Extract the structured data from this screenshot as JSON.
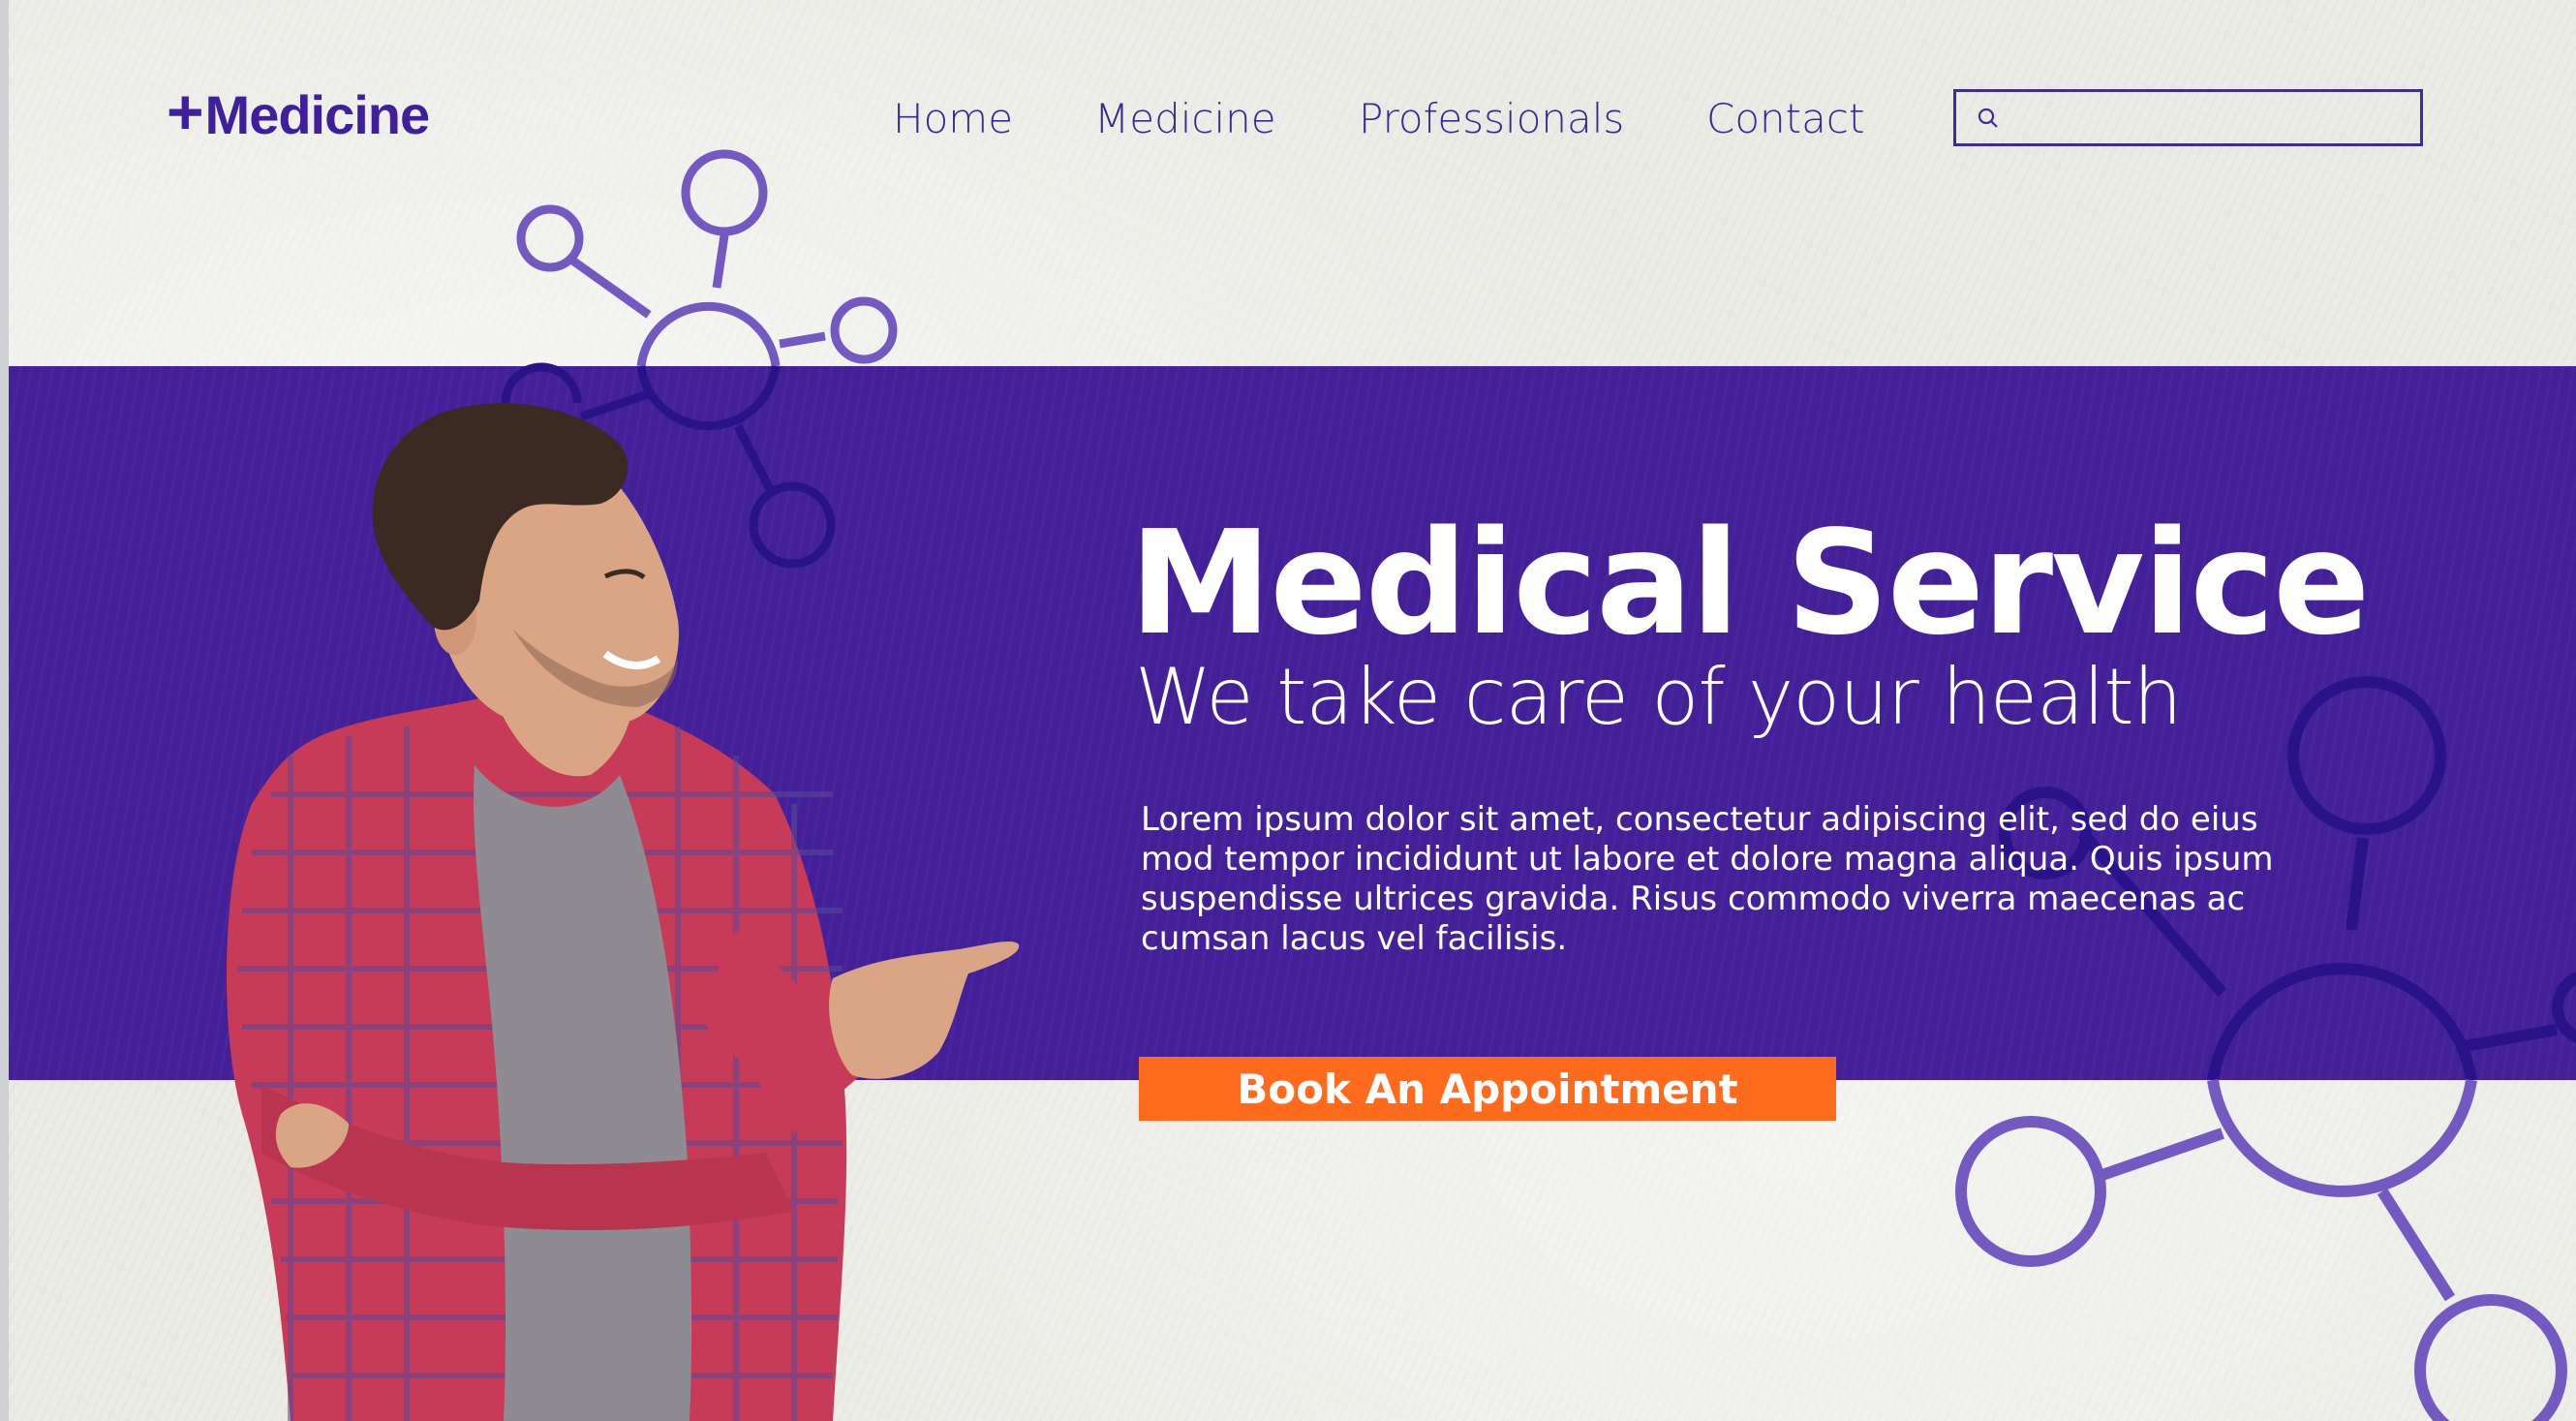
{
  "brand": {
    "name": "Medicine",
    "plus_glyph": "+",
    "color": "#3f1f9d"
  },
  "nav": {
    "items": [
      {
        "label": "Home"
      },
      {
        "label": "Medicine"
      },
      {
        "label": "Professionals"
      },
      {
        "label": "Contact"
      }
    ]
  },
  "search": {
    "placeholder": "",
    "value": "",
    "icon": "search-icon"
  },
  "hero": {
    "title": "Medical Service",
    "subtitle": "We take care of your health",
    "body": "Lorem ipsum dolor sit amet, consectetur adipiscing elit, sed do eius mod tempor incididunt ut labore et dolore magna aliqua. Quis ipsum suspendisse ultrices gravida. Risus commodo viverra maecenas ac cumsan lacus vel facilisis.",
    "cta_label": "Book An Appointment"
  },
  "colors": {
    "band": "#44219a",
    "accent": "#ff6a1c",
    "molecule_light": "#7459c0",
    "molecule_dark": "#2a138a",
    "background": "#ebebe5"
  }
}
